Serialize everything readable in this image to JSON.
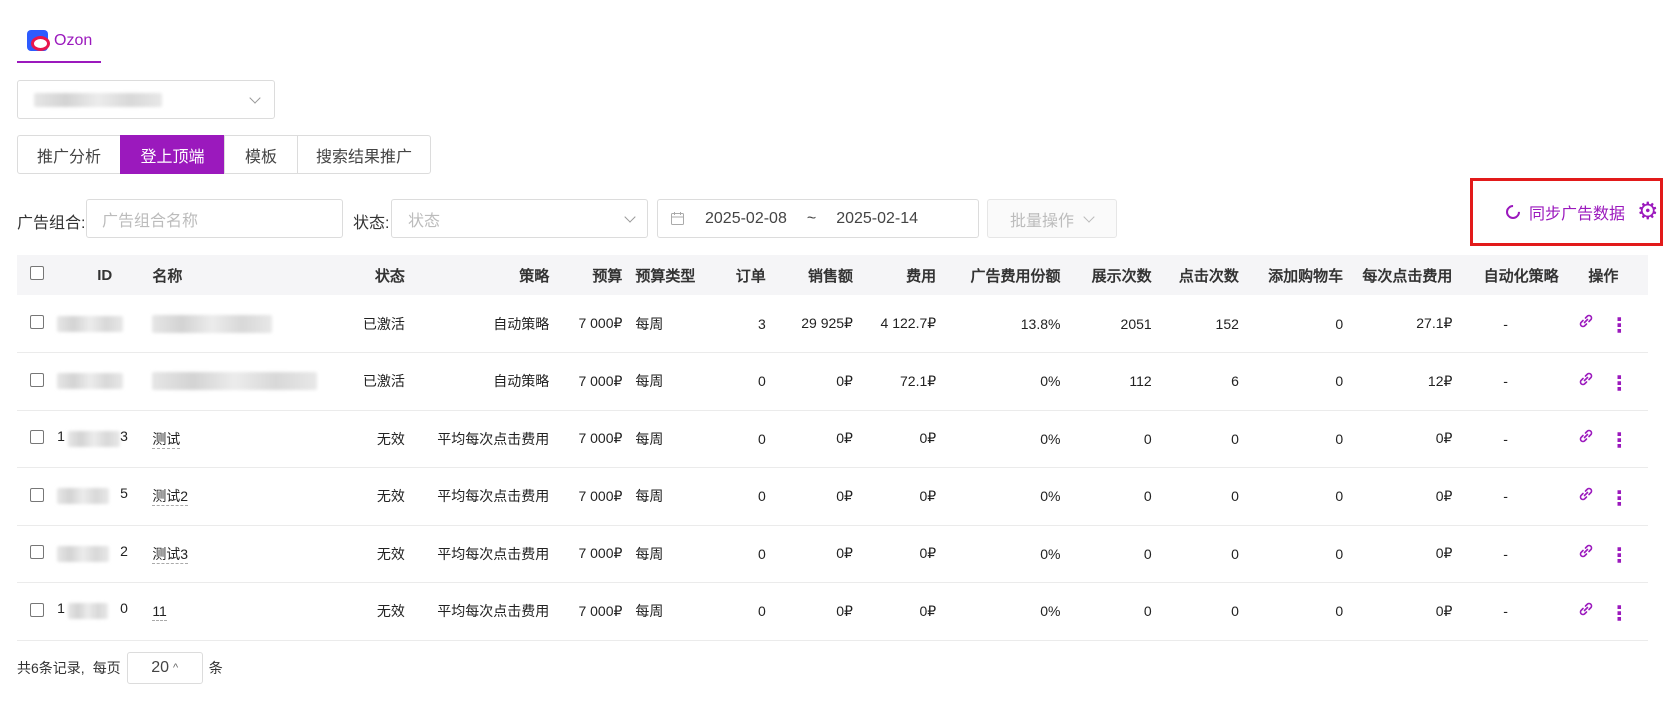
{
  "platform_tab": {
    "label": "Ozon"
  },
  "shop_select": {
    "value": ""
  },
  "view_tabs": [
    {
      "label": "推广分析",
      "active": false
    },
    {
      "label": "登上顶端",
      "active": true
    },
    {
      "label": "模板",
      "active": false
    },
    {
      "label": "搜索结果推广",
      "active": false
    }
  ],
  "filters": {
    "group_label": "广告组合:",
    "group_placeholder": "广告组合名称",
    "status_label": "状态:",
    "status_placeholder": "状态",
    "date_start": "2025-02-08",
    "date_sep": "~",
    "date_end": "2025-02-14",
    "batch_label": "批量操作"
  },
  "sync": {
    "label": "同步广告数据",
    "icon": "gear-icon",
    "highlight_color": "#e21a1a"
  },
  "accent_color": "#9b19bd",
  "table": {
    "headers": [
      "ID",
      "名称",
      "状态",
      "策略",
      "预算",
      "预算类型",
      "订单",
      "销售额",
      "费用",
      "广告费用份额",
      "展示次数",
      "点击次数",
      "添加购物车",
      "每次点击费用",
      "自动化策略",
      "操作"
    ],
    "rows": [
      {
        "id_prefix": "",
        "id_suffix": "",
        "name": "",
        "status": "已激活",
        "strategy": "自动策略",
        "budget": "7 000₽",
        "budget_type": "每周",
        "orders": "3",
        "sales": "29 925₽",
        "cost": "4 122.7₽",
        "share": "13.8%",
        "impressions": "2051",
        "clicks": "152",
        "cart": "0",
        "cpc": "27.1₽",
        "auto": "-"
      },
      {
        "id_prefix": "",
        "id_suffix": "",
        "name": "",
        "status": "已激活",
        "strategy": "自动策略",
        "budget": "7 000₽",
        "budget_type": "每周",
        "orders": "0",
        "sales": "0₽",
        "cost": "72.1₽",
        "share": "0%",
        "impressions": "112",
        "clicks": "6",
        "cart": "0",
        "cpc": "12₽",
        "auto": "-"
      },
      {
        "id_prefix": "1",
        "id_suffix": "3",
        "name": "测试",
        "status": "无效",
        "strategy": "平均每次点击费用",
        "budget": "7 000₽",
        "budget_type": "每周",
        "orders": "0",
        "sales": "0₽",
        "cost": "0₽",
        "share": "0%",
        "impressions": "0",
        "clicks": "0",
        "cart": "0",
        "cpc": "0₽",
        "auto": "-"
      },
      {
        "id_prefix": "",
        "id_suffix": "5",
        "name": "测试2",
        "status": "无效",
        "strategy": "平均每次点击费用",
        "budget": "7 000₽",
        "budget_type": "每周",
        "orders": "0",
        "sales": "0₽",
        "cost": "0₽",
        "share": "0%",
        "impressions": "0",
        "clicks": "0",
        "cart": "0",
        "cpc": "0₽",
        "auto": "-"
      },
      {
        "id_prefix": "",
        "id_suffix": "2",
        "name": "测试3",
        "status": "无效",
        "strategy": "平均每次点击费用",
        "budget": "7 000₽",
        "budget_type": "每周",
        "orders": "0",
        "sales": "0₽",
        "cost": "0₽",
        "share": "0%",
        "impressions": "0",
        "clicks": "0",
        "cart": "0",
        "cpc": "0₽",
        "auto": "-"
      },
      {
        "id_prefix": "1",
        "id_suffix": "0",
        "name": "11",
        "status": "无效",
        "strategy": "平均每次点击费用",
        "budget": "7 000₽",
        "budget_type": "每周",
        "orders": "0",
        "sales": "0₽",
        "cost": "0₽",
        "share": "0%",
        "impressions": "0",
        "clicks": "0",
        "cart": "0",
        "cpc": "0₽",
        "auto": "-"
      }
    ]
  },
  "pagination": {
    "total_text": "共6条记录,",
    "per_page_label": "每页",
    "per_page_value": "20",
    "unit": "条"
  }
}
